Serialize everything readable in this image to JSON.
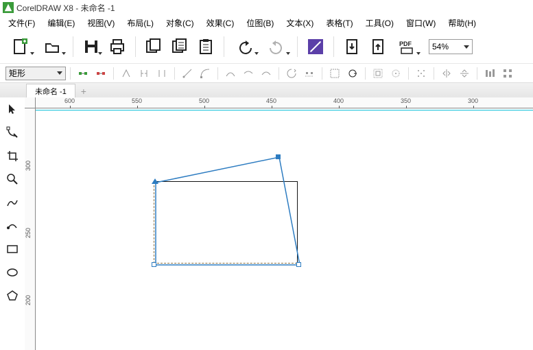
{
  "title": {
    "app": "CorelDRAW X8",
    "doc": "未命名 -1",
    "sep": " - "
  },
  "menu": {
    "file": "文件(F)",
    "edit": "编辑(E)",
    "view": "视图(V)",
    "layout": "布局(L)",
    "object": "对象(C)",
    "effect": "效果(C)",
    "bitmap": "位图(B)",
    "text": "文本(X)",
    "table": "表格(T)",
    "tools": "工具(O)",
    "window": "窗口(W)",
    "help": "帮助(H)"
  },
  "toolbar": {
    "zoom": "54%"
  },
  "property": {
    "shape_type": "矩形"
  },
  "tabs": {
    "active": "未命名 -1"
  },
  "ruler_h": [
    "600",
    "550",
    "500",
    "450",
    "400",
    "350",
    "300"
  ],
  "ruler_v": [
    "300",
    "250",
    "200"
  ],
  "icons": {
    "new": "new",
    "open": "open",
    "save": "save",
    "print": "print",
    "copy": "copy",
    "paste": "paste",
    "undo": "undo",
    "redo": "redo",
    "pdf": "PDF"
  }
}
